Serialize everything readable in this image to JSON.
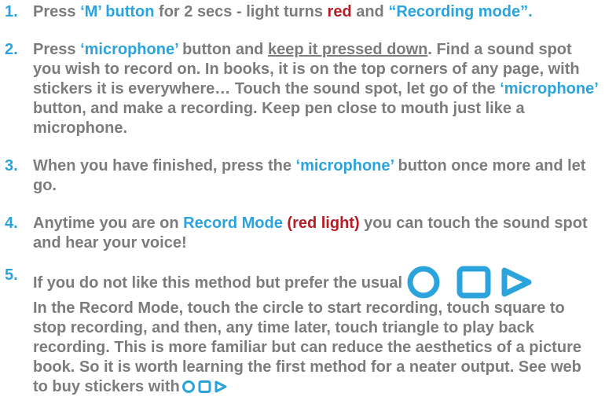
{
  "colors": {
    "text": "#7c7c7c",
    "accent_blue": "#2ba3dc",
    "accent_red": "#b51d24"
  },
  "steps": [
    {
      "num": "1.",
      "a": "Press ",
      "b": "‘M’ button",
      "c": " for 2 secs - light turns ",
      "d": "red",
      "e": " and ",
      "f": "“Recording mode”."
    },
    {
      "num": "2.",
      "a": "Press ",
      "b": "‘microphone’",
      "c": " button and ",
      "d": "keep it pressed down",
      "e": ". Find a sound spot you wish to record on. In books, it is on the top corners of any page, with stickers it is everywhere… Touch the sound spot, let go of the ",
      "f": "‘microphone’",
      "g": " button, and make a recording. Keep pen close to mouth just like a microphone."
    },
    {
      "num": "3.",
      "a": "When you have finished, press the ",
      "b": "‘microphone’",
      "c": " button once more and let go."
    },
    {
      "num": "4.",
      "a": "Anytime you are on ",
      "b": "Record Mode",
      "c": " ",
      "d": "(red light)",
      "e": " you can touch the sound spot and hear your voice!"
    },
    {
      "num": "5.",
      "a": "If you do not like this method but prefer the usual",
      "b": "In the Record Mode, touch the circle to start recording, touch square to stop recording, and then, any time later, touch triangle to play back recording. This is more familiar but can reduce the aesthetics of a picture book. So it is worth learning the first method for a neater output. See web to buy stickers with",
      "icons": [
        "circle-icon",
        "square-icon",
        "triangle-play-icon"
      ]
    }
  ]
}
